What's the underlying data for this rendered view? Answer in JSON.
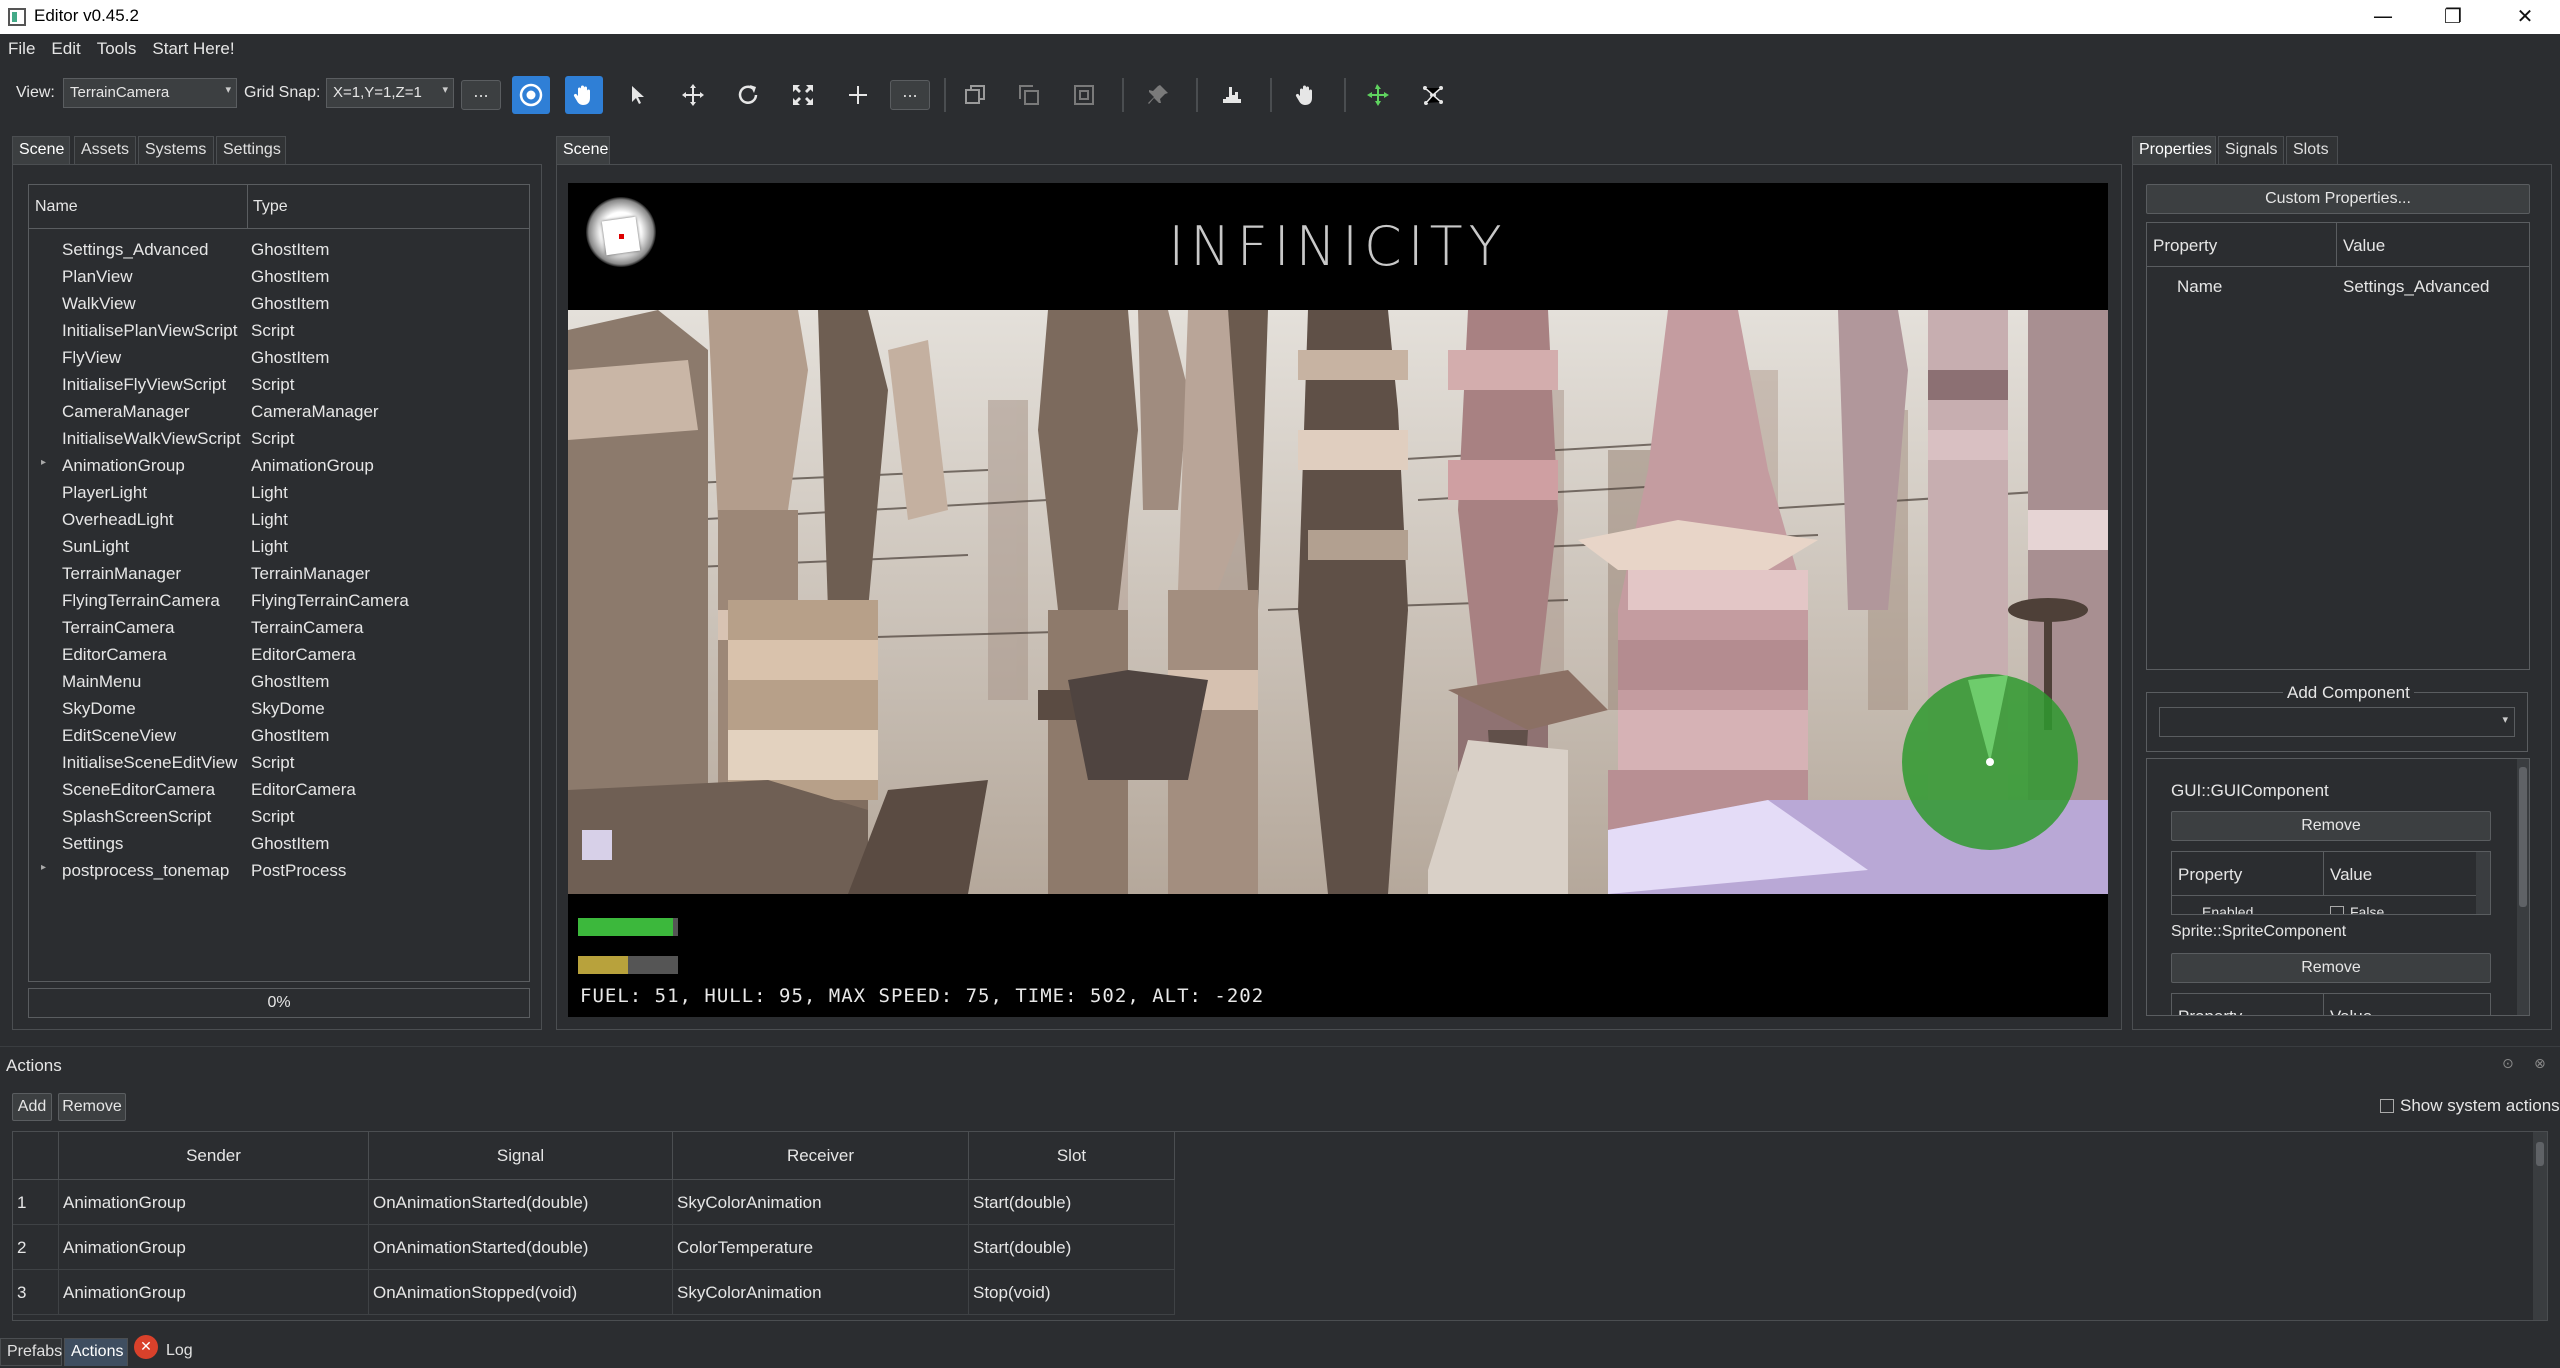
{
  "window": {
    "title": "Editor v0.45.2",
    "minimize": "—",
    "maximize": "❐",
    "close": "✕"
  },
  "menu": [
    "File",
    "Edit",
    "Tools",
    "Start Here!"
  ],
  "toolbar": {
    "view_label": "View:",
    "view_value": "TerrainCamera",
    "grid_label": "Grid Snap:",
    "grid_value": "X=1,Y=1,Z=1",
    "more_label": "...",
    "more2_label": "..."
  },
  "left_panel": {
    "tabs": [
      "Scene",
      "Assets",
      "Systems",
      "Settings"
    ],
    "columns": [
      "Name",
      "Type"
    ],
    "rows": [
      {
        "name": "Settings_Advanced",
        "type": "GhostItem"
      },
      {
        "name": "PlanView",
        "type": "GhostItem"
      },
      {
        "name": "WalkView",
        "type": "GhostItem"
      },
      {
        "name": "InitialisePlanViewScript",
        "type": "Script"
      },
      {
        "name": "FlyView",
        "type": "GhostItem"
      },
      {
        "name": "InitialiseFlyViewScript",
        "type": "Script"
      },
      {
        "name": "CameraManager",
        "type": "CameraManager"
      },
      {
        "name": "InitialiseWalkViewScript",
        "type": "Script"
      },
      {
        "name": "AnimationGroup",
        "type": "AnimationGroup",
        "expandable": true
      },
      {
        "name": "PlayerLight",
        "type": "Light"
      },
      {
        "name": "OverheadLight",
        "type": "Light"
      },
      {
        "name": "SunLight",
        "type": "Light"
      },
      {
        "name": "TerrainManager",
        "type": "TerrainManager"
      },
      {
        "name": "FlyingTerrainCamera",
        "type": "FlyingTerrainCamera"
      },
      {
        "name": "TerrainCamera",
        "type": "TerrainCamera"
      },
      {
        "name": "EditorCamera",
        "type": "EditorCamera"
      },
      {
        "name": "MainMenu",
        "type": "GhostItem"
      },
      {
        "name": "SkyDome",
        "type": "SkyDome"
      },
      {
        "name": "EditSceneView",
        "type": "GhostItem"
      },
      {
        "name": "InitialiseSceneEditView",
        "type": "Script"
      },
      {
        "name": "SceneEditorCamera",
        "type": "EditorCamera"
      },
      {
        "name": "SplashScreenScript",
        "type": "Script"
      },
      {
        "name": "Settings",
        "type": "GhostItem"
      },
      {
        "name": "postprocess_tonemap",
        "type": "PostProcess",
        "expandable": true
      }
    ],
    "progress": "0%"
  },
  "center_panel": {
    "tab": "Scene",
    "game_title": "INFINICITY",
    "fuel_level": 0.95,
    "hull_level": 0.5,
    "status": "FUEL: 51, HULL: 95, MAX SPEED: 75, TIME: 502, ALT: -202"
  },
  "right_panel": {
    "tabs": [
      "Properties",
      "Signals",
      "Slots"
    ],
    "custom_properties": "Custom Properties...",
    "columns": [
      "Property",
      "Value"
    ],
    "rows": [
      {
        "property": "Name",
        "value": "Settings_Advanced"
      }
    ],
    "add_component": "Add Component",
    "components": [
      {
        "name": "GUI::GUIComponent",
        "remove": "Remove",
        "columns": [
          "Property",
          "Value"
        ],
        "partial_row": "Enabled",
        "partial_value": "False"
      },
      {
        "name": "Sprite::SpriteComponent",
        "remove": "Remove",
        "columns": [
          "Property",
          "Value"
        ]
      }
    ]
  },
  "actions": {
    "title": "Actions",
    "add": "Add",
    "remove": "Remove",
    "show_system": "Show system actions",
    "columns": [
      "Sender",
      "Signal",
      "Receiver",
      "Slot"
    ],
    "rows": [
      {
        "n": "1",
        "sender": "AnimationGroup",
        "signal": "OnAnimationStarted(double)",
        "receiver": "SkyColorAnimation",
        "slot": "Start(double)"
      },
      {
        "n": "2",
        "sender": "AnimationGroup",
        "signal": "OnAnimationStarted(double)",
        "receiver": "ColorTemperature",
        "slot": "Start(double)"
      },
      {
        "n": "3",
        "sender": "AnimationGroup",
        "signal": "OnAnimationStopped(void)",
        "receiver": "SkyColorAnimation",
        "slot": "Stop(void)"
      }
    ]
  },
  "bottom_tabs": [
    "Prefabs",
    "Actions",
    "Log"
  ],
  "colors": {
    "accent": "#2f7fd6",
    "fuel": "#3cb83c",
    "hull": "#b8a23c",
    "radar": "#2f9a2f",
    "error": "#d9412b"
  },
  "icons": [
    "target-icon",
    "hand-icon",
    "pointer-icon",
    "move-icon",
    "rotate-icon",
    "scale-icon",
    "add-icon",
    "copy-icon",
    "paste-icon",
    "duplicate-icon",
    "pin-icon",
    "terrain-icon",
    "grab-icon",
    "axis-icon",
    "network-icon"
  ]
}
